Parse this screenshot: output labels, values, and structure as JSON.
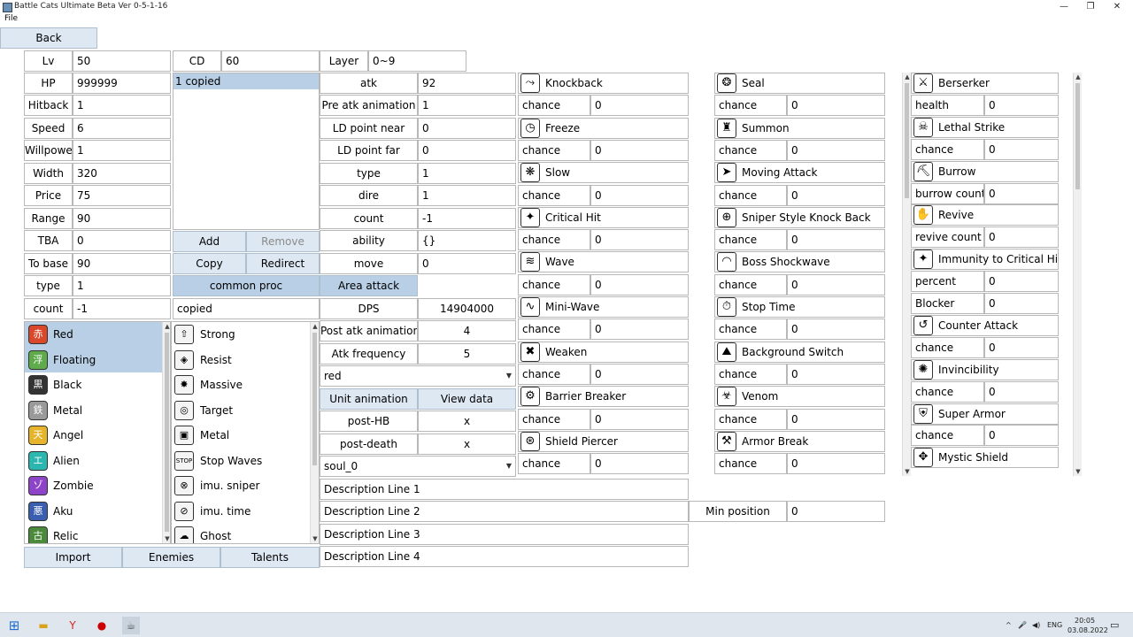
{
  "window": {
    "title": "Battle Cats Ultimate Beta Ver 0-5-1-16",
    "menu_file": "File"
  },
  "back_label": "Back",
  "lv": {
    "label": "Lv",
    "value": "50"
  },
  "cd": {
    "label": "CD",
    "value": "60"
  },
  "layer": {
    "label": "Layer",
    "value": "0~9"
  },
  "stats_left": [
    {
      "label": "HP",
      "value": "999999"
    },
    {
      "label": "Hitback",
      "value": "1"
    },
    {
      "label": "Speed",
      "value": "6"
    },
    {
      "label": "Willpower",
      "value": "1"
    },
    {
      "label": "Width",
      "value": "320"
    },
    {
      "label": "Price",
      "value": "75"
    },
    {
      "label": "Range",
      "value": "90"
    },
    {
      "label": "TBA",
      "value": "0"
    },
    {
      "label": "To base",
      "value": "90"
    },
    {
      "label": "type",
      "value": "1"
    },
    {
      "label": "count",
      "value": "-1"
    }
  ],
  "copied_list": {
    "item": "1 copied"
  },
  "list_buttons": {
    "add": "Add",
    "remove": "Remove",
    "copy": "Copy",
    "redirect": "Redirect",
    "common_proc": "common proc",
    "copied": "copied"
  },
  "attack": [
    {
      "label": "atk",
      "value": "92"
    },
    {
      "label": "Pre atk animation",
      "value": "1"
    },
    {
      "label": "LD point near",
      "value": "0"
    },
    {
      "label": "LD point far",
      "value": "0"
    },
    {
      "label": "type",
      "value": "1"
    },
    {
      "label": "dire",
      "value": "1"
    },
    {
      "label": "count",
      "value": "-1"
    },
    {
      "label": "ability",
      "value": "{}"
    },
    {
      "label": "move",
      "value": "0"
    }
  ],
  "area_attack": "Area attack",
  "derived": [
    {
      "label": "DPS",
      "value": "14904000"
    },
    {
      "label": "Post atk animation",
      "value": "4"
    },
    {
      "label": "Atk frequency",
      "value": "5"
    }
  ],
  "trait_select": "red",
  "unit_animation": "Unit animation",
  "view_data": "View data",
  "post_hb": {
    "label": "post-HB",
    "value": "x"
  },
  "post_death": {
    "label": "post-death",
    "value": "x"
  },
  "soul_select": "soul_0",
  "descriptions": [
    "Description Line 1",
    "Description Line 2",
    "Description Line 3",
    "Description Line 4"
  ],
  "min_position": {
    "label": "Min position",
    "value": "0"
  },
  "traits": [
    {
      "name": "Red",
      "glyph": "赤",
      "color": "#d9482b",
      "selected": true
    },
    {
      "name": "Floating",
      "glyph": "浮",
      "color": "#5faa4a",
      "selected": true
    },
    {
      "name": "Black",
      "glyph": "黒",
      "color": "#333333",
      "selected": false
    },
    {
      "name": "Metal",
      "glyph": "鉄",
      "color": "#9a9a9a",
      "selected": false
    },
    {
      "name": "Angel",
      "glyph": "天",
      "color": "#e5b42a",
      "selected": false
    },
    {
      "name": "Alien",
      "glyph": "エ",
      "color": "#2bb6b0",
      "selected": false
    },
    {
      "name": "Zombie",
      "glyph": "ゾ",
      "color": "#8e44c9",
      "selected": false
    },
    {
      "name": "Aku",
      "glyph": "悪",
      "color": "#3a5fb0",
      "selected": false
    },
    {
      "name": "Relic",
      "glyph": "古",
      "color": "#4a8a3a",
      "selected": false
    }
  ],
  "abilities_list": [
    {
      "name": "Strong",
      "glyph": "⇧"
    },
    {
      "name": "Resist",
      "glyph": "◈"
    },
    {
      "name": "Massive",
      "glyph": "✸"
    },
    {
      "name": "Target",
      "glyph": "◎"
    },
    {
      "name": "Metal",
      "glyph": "▣"
    },
    {
      "name": "Stop Waves",
      "glyph": "STOP"
    },
    {
      "name": "imu. sniper",
      "glyph": "⊗"
    },
    {
      "name": "imu. time",
      "glyph": "⊘"
    },
    {
      "name": "Ghost",
      "glyph": "☁"
    }
  ],
  "bottom_buttons": {
    "import": "Import",
    "enemies": "Enemies",
    "talents": "Talents"
  },
  "procs_col1": [
    {
      "name": "Knockback",
      "glyph": "⤳",
      "field": "chance",
      "value": "0"
    },
    {
      "name": "Freeze",
      "glyph": "◷",
      "field": "chance",
      "value": "0"
    },
    {
      "name": "Slow",
      "glyph": "❋",
      "field": "chance",
      "value": "0"
    },
    {
      "name": "Critical Hit",
      "glyph": "✦",
      "field": "chance",
      "value": "0"
    },
    {
      "name": "Wave",
      "glyph": "≋",
      "field": "chance",
      "value": "0"
    },
    {
      "name": "Mini-Wave",
      "glyph": "∿",
      "field": "chance",
      "value": "0"
    },
    {
      "name": "Weaken",
      "glyph": "✖",
      "field": "chance",
      "value": "0"
    },
    {
      "name": "Barrier Breaker",
      "glyph": "⚙",
      "field": "chance",
      "value": "0"
    },
    {
      "name": "Shield Piercer",
      "glyph": "⊛",
      "field": "chance",
      "value": "0"
    }
  ],
  "procs_col2": [
    {
      "name": "Seal",
      "glyph": "❂",
      "field": "chance",
      "value": "0"
    },
    {
      "name": "Summon",
      "glyph": "♜",
      "field": "chance",
      "value": "0"
    },
    {
      "name": "Moving Attack",
      "glyph": "➤",
      "field": "chance",
      "value": "0"
    },
    {
      "name": "Sniper Style Knock Back",
      "glyph": "⊕",
      "field": "chance",
      "value": "0"
    },
    {
      "name": "Boss Shockwave",
      "glyph": "◠",
      "field": "chance",
      "value": "0"
    },
    {
      "name": "Stop Time",
      "glyph": "⏱",
      "field": "chance",
      "value": "0"
    },
    {
      "name": "Background Switch",
      "glyph": "⛰",
      "field": "chance",
      "value": "0"
    },
    {
      "name": "Venom",
      "glyph": "☣",
      "field": "chance",
      "value": "0"
    },
    {
      "name": "Armor Break",
      "glyph": "⚒",
      "field": "chance",
      "value": "0"
    }
  ],
  "procs_col3": [
    {
      "name": "Berserker",
      "glyph": "⚔",
      "field": "health",
      "value": "0"
    },
    {
      "name": "Lethal Strike",
      "glyph": "☠",
      "field": "chance",
      "value": "0"
    },
    {
      "name": "Burrow",
      "glyph": "⛏",
      "field": "burrow count",
      "value": "0"
    },
    {
      "name": "Revive",
      "glyph": "✋",
      "field": "revive count",
      "value": "0"
    },
    {
      "name": "Immunity to Critical Hit",
      "glyph": "✦",
      "fields": [
        {
          "field": "percent",
          "value": "0"
        },
        {
          "field": "Blocker",
          "value": "0"
        }
      ]
    },
    {
      "name": "Counter Attack",
      "glyph": "↺",
      "field": "chance",
      "value": "0"
    },
    {
      "name": "Invincibility",
      "glyph": "✺",
      "field": "chance",
      "value": "0"
    },
    {
      "name": "Super Armor",
      "glyph": "⛨",
      "field": "chance",
      "value": "0"
    },
    {
      "name": "Mystic Shield",
      "glyph": "✥"
    }
  ],
  "taskbar": {
    "lang": "ENG",
    "time": "20:05",
    "date": "03.08.2022"
  }
}
